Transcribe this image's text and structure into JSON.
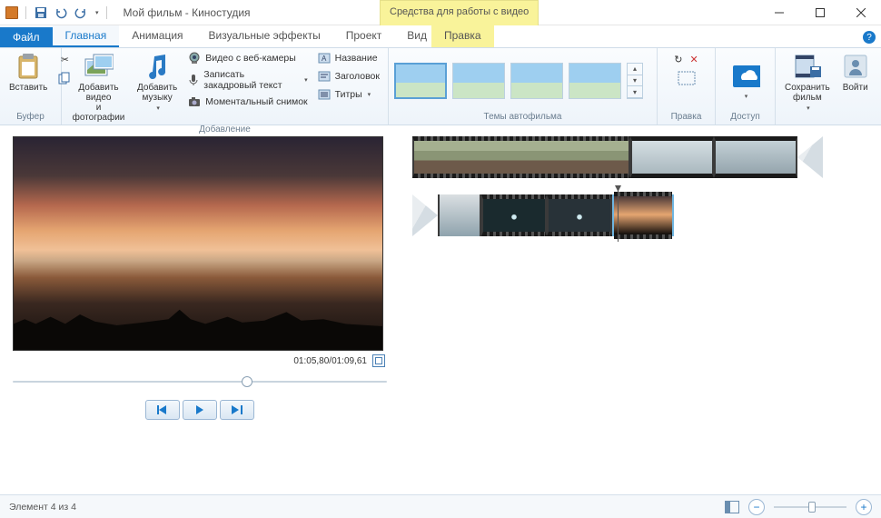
{
  "titlebar": {
    "title": "Мой фильм - Киностудия",
    "context_tab": "Средства для работы с видео"
  },
  "tabs": {
    "file": "Файл",
    "items": [
      "Главная",
      "Анимация",
      "Визуальные эффекты",
      "Проект",
      "Вид"
    ],
    "context": "Правка",
    "active_index": 0
  },
  "ribbon": {
    "groups": {
      "buffer": {
        "label": "Буфер",
        "paste": "Вставить"
      },
      "add": {
        "label": "Добавление",
        "add_video": "Добавить видео\nи фотографии",
        "add_music": "Добавить\nмузыку",
        "webcam": "Видео с веб-камеры",
        "narration": "Записать закадровый текст",
        "snapshot": "Моментальный снимок",
        "cap_name": "Название",
        "cap_title": "Заголовок",
        "cap_credits": "Титры"
      },
      "themes": {
        "label": "Темы автофильма"
      },
      "edit": {
        "label": "Правка"
      },
      "access": {
        "label": "Доступ"
      },
      "save": {
        "save": "Сохранить\nфильм",
        "signin": "Войти"
      }
    }
  },
  "preview": {
    "time": "01:05,80/01:09,61"
  },
  "statusbar": {
    "status": "Элемент 4 из 4"
  }
}
